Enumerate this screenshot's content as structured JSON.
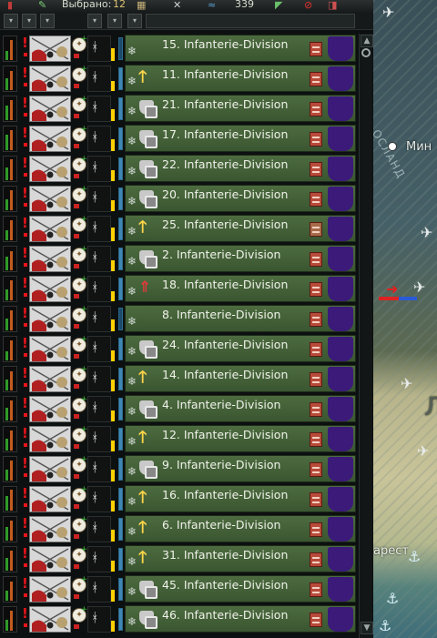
{
  "toolbar": {
    "selected_label": "Выбрано:",
    "selected_count": "12",
    "manpower_value": "339"
  },
  "map": {
    "city_label": "Мин",
    "region_label": "ОСЛАНД",
    "city_label_2": "арест",
    "letter_label": "Л"
  },
  "divisions": [
    {
      "name": "15. Infanterie-Division",
      "tactic": "none"
    },
    {
      "name": "11. Infanterie-Division",
      "tactic": "attack"
    },
    {
      "name": "21. Infanterie-Division",
      "tactic": "defend"
    },
    {
      "name": "17. Infanterie-Division",
      "tactic": "defend"
    },
    {
      "name": "22. Infanterie-Division",
      "tactic": "defend"
    },
    {
      "name": "20. Infanterie-Division",
      "tactic": "defend"
    },
    {
      "name": "25. Infanterie-Division",
      "tactic": "attack"
    },
    {
      "name": "2. Infanterie-Division",
      "tactic": "defend"
    },
    {
      "name": "18. Infanterie-Division",
      "tactic": "red"
    },
    {
      "name": "8. Infanterie-Division",
      "tactic": "none"
    },
    {
      "name": "24. Infanterie-Division",
      "tactic": "defend"
    },
    {
      "name": "14. Infanterie-Division",
      "tactic": "attack"
    },
    {
      "name": "4. Infanterie-Division",
      "tactic": "defend"
    },
    {
      "name": "12. Infanterie-Division",
      "tactic": "attack"
    },
    {
      "name": "9. Infanterie-Division",
      "tactic": "defend"
    },
    {
      "name": "16. Infanterie-Division",
      "tactic": "attack"
    },
    {
      "name": "6. Infanterie-Division",
      "tactic": "attack"
    },
    {
      "name": "31. Infanterie-Division",
      "tactic": "attack"
    },
    {
      "name": "45. Infanterie-Division",
      "tactic": "defend"
    },
    {
      "name": "46. Infanterie-Division",
      "tactic": "defend"
    }
  ],
  "icons": {
    "warning": "warning-icon",
    "snow": "snowflake-icon",
    "equipment": "equipment-icon",
    "flag": "nation-flag-icon"
  },
  "colors": {
    "panel": "#44613a",
    "warning": "#e8141a",
    "supply": "#ffd200",
    "flag": "#3b1a7a"
  }
}
